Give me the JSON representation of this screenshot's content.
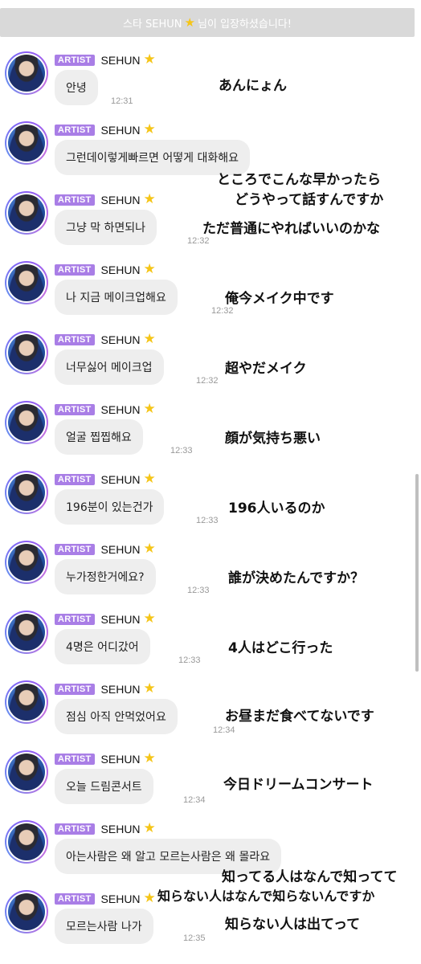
{
  "banner": {
    "before": "스타 SEHUN",
    "after": "님이 입장하셨습니다!"
  },
  "sender": {
    "badge": "ARTIST",
    "name": "SEHUN"
  },
  "messages": [
    {
      "text": "안녕",
      "time": "12:31",
      "translation": [
        "あんにょん"
      ]
    },
    {
      "text": "그런데이렇게빠르면 어떻게 대화해요",
      "time": "",
      "translation": [
        "ところでこんな早かったら",
        "どうやって話すんですか"
      ]
    },
    {
      "text": "그냥 막 하면되나",
      "time": "12:32",
      "translation": [
        "ただ普通にやればいいのかな"
      ]
    },
    {
      "text": "나 지금 메이크업해요",
      "time": "12:32",
      "translation": [
        "俺今メイク中です"
      ]
    },
    {
      "text": "너무싫어 메이크업",
      "time": "12:32",
      "translation": [
        "超やだメイク"
      ]
    },
    {
      "text": "얼굴 찝찝해요",
      "time": "12:33",
      "translation": [
        "顔が気持ち悪い"
      ]
    },
    {
      "text": "196분이 있는건가",
      "time": "12:33",
      "translation": [
        "196人いるのか"
      ]
    },
    {
      "text": "누가정한거에요?",
      "time": "12:33",
      "translation": [
        "誰が決めたんですか？"
      ]
    },
    {
      "text": "4명은 어디갔어",
      "time": "12:33",
      "translation": [
        "4人はどこ行った"
      ]
    },
    {
      "text": "점심 아직 안먹었어요",
      "time": "12:34",
      "translation": [
        "お昼まだ食べてないです"
      ]
    },
    {
      "text": "오늘 드림콘서트",
      "time": "12:34",
      "translation": [
        "今日ドリームコンサート"
      ]
    },
    {
      "text": "아는사람은 왜 알고 모르는사람은 왜 몰라요",
      "time": "",
      "translation": [
        "知ってる人はなんで知ってて",
        "知らない人はなんで知らないんですか"
      ]
    },
    {
      "text": "모르는사람 나가",
      "time": "12:35",
      "translation": [
        "知らない人は出てって"
      ]
    }
  ]
}
